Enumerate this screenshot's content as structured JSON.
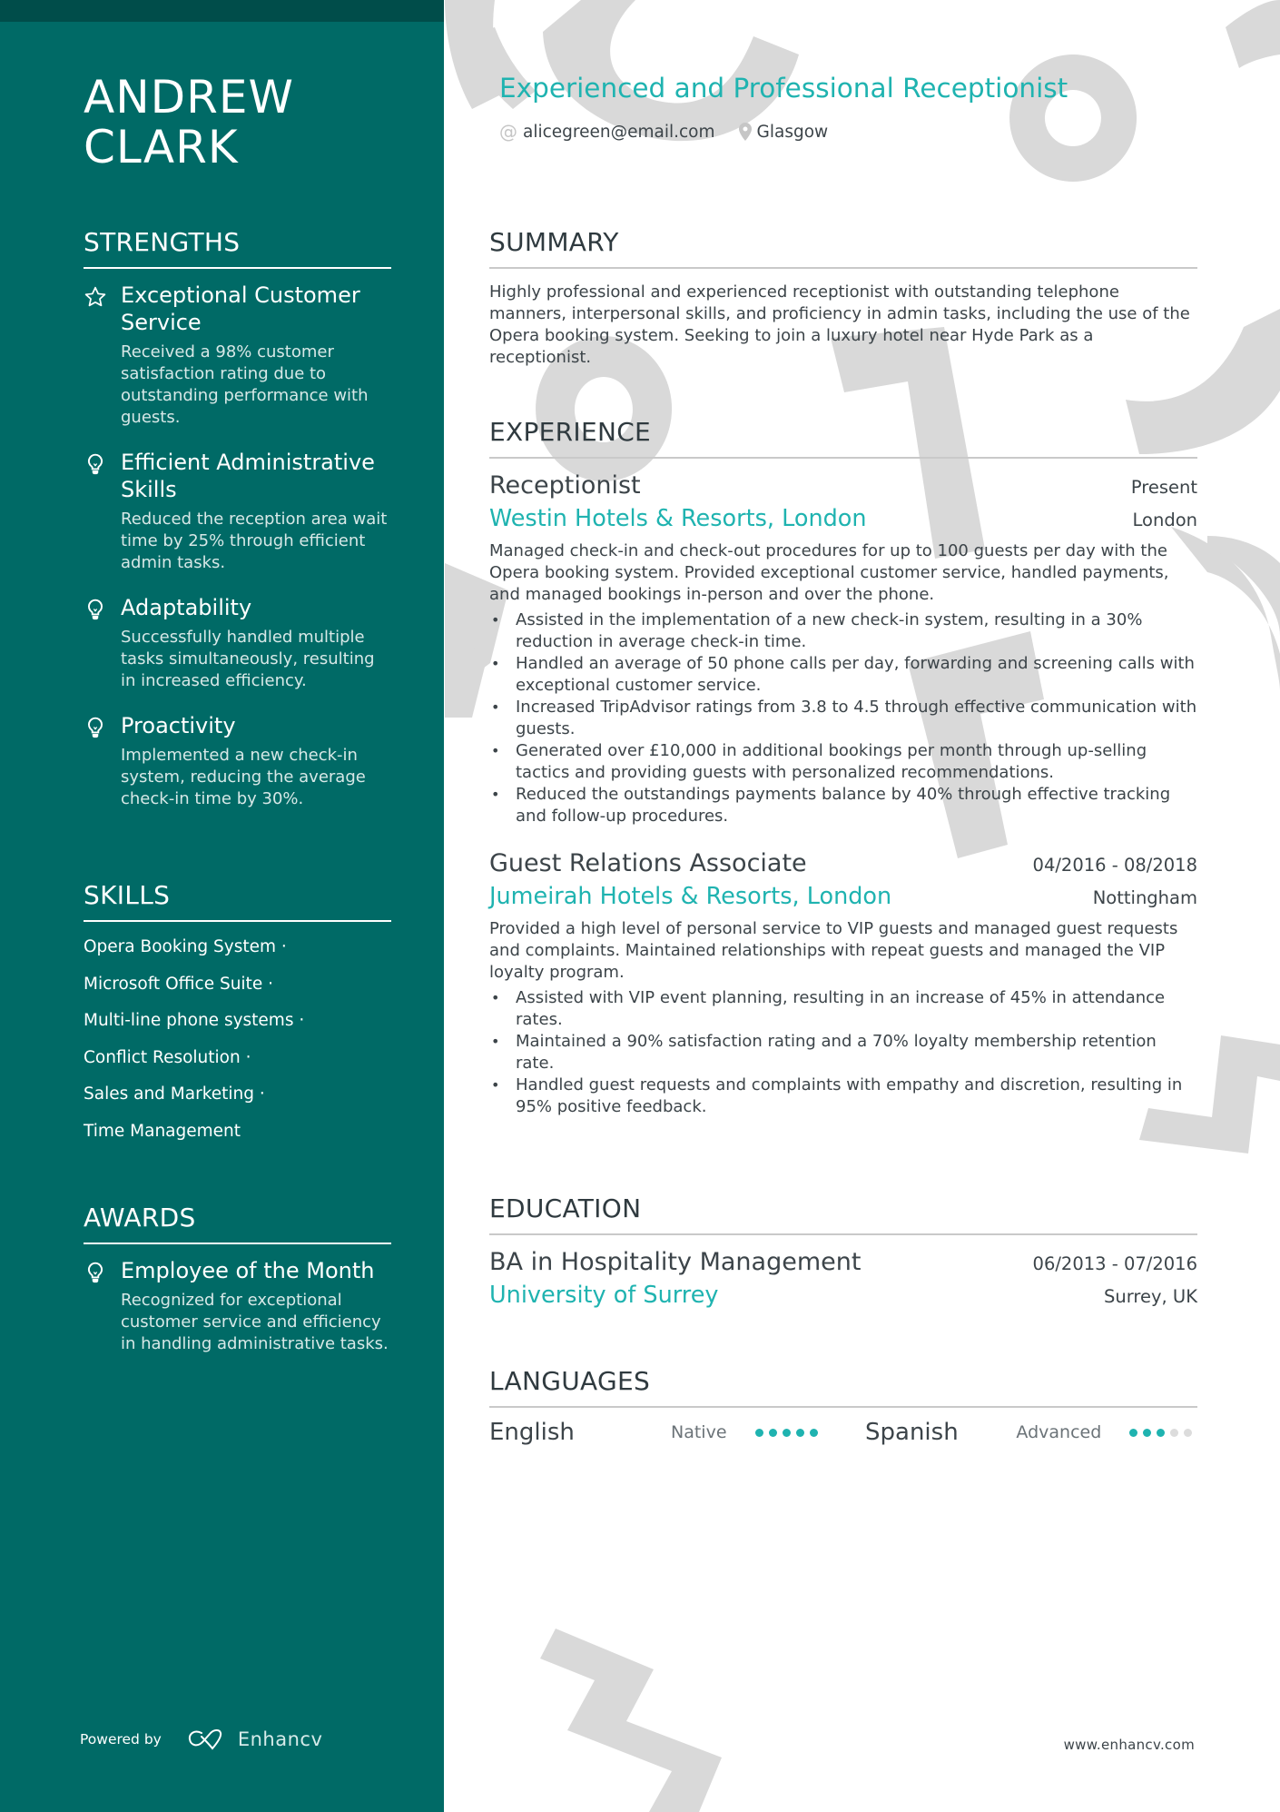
{
  "colors": {
    "sidebar": "#006a66",
    "sidebar_topbar": "#004d4a",
    "accent": "#1fb3b0",
    "text": "#3c4449",
    "decoration": "#d9d9d9"
  },
  "sidebar": {
    "name_line1": "ANDREW",
    "name_line2": "CLARK",
    "strengths": {
      "heading": "STRENGTHS",
      "items": [
        {
          "icon": "star-icon",
          "title": "Exceptional Customer Service",
          "desc": "Received a 98% customer satisfaction rating due to outstanding performance with guests."
        },
        {
          "icon": "lightbulb-icon",
          "title": "Efficient Administrative Skills",
          "desc": "Reduced the reception area wait time by 25% through efficient admin tasks."
        },
        {
          "icon": "lightbulb-icon",
          "title": "Adaptability",
          "desc": "Successfully handled multiple tasks simultaneously, resulting in increased efficiency."
        },
        {
          "icon": "lightbulb-icon",
          "title": "Proactivity",
          "desc": "Implemented a new check-in system, reducing the average check-in time by 30%."
        }
      ]
    },
    "skills": {
      "heading": "SKILLS",
      "items": [
        "Opera Booking System ·",
        "Microsoft Office Suite ·",
        "Multi-line phone systems ·",
        "Conflict Resolution ·",
        "Sales and Marketing ·",
        "Time Management"
      ]
    },
    "awards": {
      "heading": "AWARDS",
      "items": [
        {
          "icon": "lightbulb-icon",
          "title": "Employee of the Month",
          "desc": "Recognized for exceptional customer service and efficiency in handling administrative tasks."
        }
      ]
    },
    "footer": {
      "powered_by": "Powered by",
      "brand": "Enhancv"
    }
  },
  "main": {
    "headline": "Experienced and Professional Receptionist",
    "contacts": [
      {
        "icon": "at-icon",
        "text": "alicegreen@email.com"
      },
      {
        "icon": "location-pin-icon",
        "text": "Glasgow"
      }
    ],
    "summary": {
      "heading": "SUMMARY",
      "text": "Highly professional and experienced receptionist with outstanding telephone manners, interpersonal skills, and proficiency in admin tasks, including the use of the Opera booking system. Seeking to join a luxury hotel near Hyde Park as a receptionist."
    },
    "experience": {
      "heading": "EXPERIENCE",
      "entries": [
        {
          "role": "Receptionist",
          "date": "Present",
          "company": "Westin Hotels & Resorts, London",
          "location": "London",
          "desc": "Managed check-in and check-out procedures for up to 100 guests per day with the Opera booking system. Provided exceptional customer service, handled payments, and managed bookings in-person and over the phone.",
          "bullets": [
            "Assisted in the implementation of a new check-in system, resulting in a 30% reduction in average check-in time.",
            "Handled an average of 50 phone calls per day, forwarding and screening calls with exceptional customer service.",
            "Increased TripAdvisor ratings from 3.8 to 4.5 through effective communication with guests.",
            "Generated over £10,000 in additional bookings per month through up-selling tactics and providing guests with personalized recommendations.",
            "Reduced the outstandings payments balance by 40% through effective tracking and follow-up procedures."
          ]
        },
        {
          "role": "Guest Relations Associate",
          "date": "04/2016 - 08/2018",
          "company": "Jumeirah Hotels & Resorts, London",
          "location": "Nottingham",
          "desc": "Provided a high level of personal service to VIP guests and managed guest requests and complaints. Maintained relationships with repeat guests and managed the VIP loyalty program.",
          "bullets": [
            "Assisted with VIP event planning, resulting in an increase of 45% in attendance rates.",
            "Maintained a 90% satisfaction rating and a 70% loyalty membership retention rate.",
            "Handled guest requests and complaints with empathy and discretion, resulting in 95% positive feedback."
          ]
        }
      ]
    },
    "education": {
      "heading": "EDUCATION",
      "entries": [
        {
          "degree": "BA in Hospitality Management",
          "date": "06/2013 - 07/2016",
          "school": "University of Surrey",
          "location": "Surrey, UK"
        }
      ]
    },
    "languages": {
      "heading": "LANGUAGES",
      "items": [
        {
          "name": "English",
          "level": "Native",
          "rating": 5,
          "max": 5
        },
        {
          "name": "Spanish",
          "level": "Advanced",
          "rating": 3,
          "max": 5
        }
      ]
    },
    "website": "www.enhancv.com"
  }
}
